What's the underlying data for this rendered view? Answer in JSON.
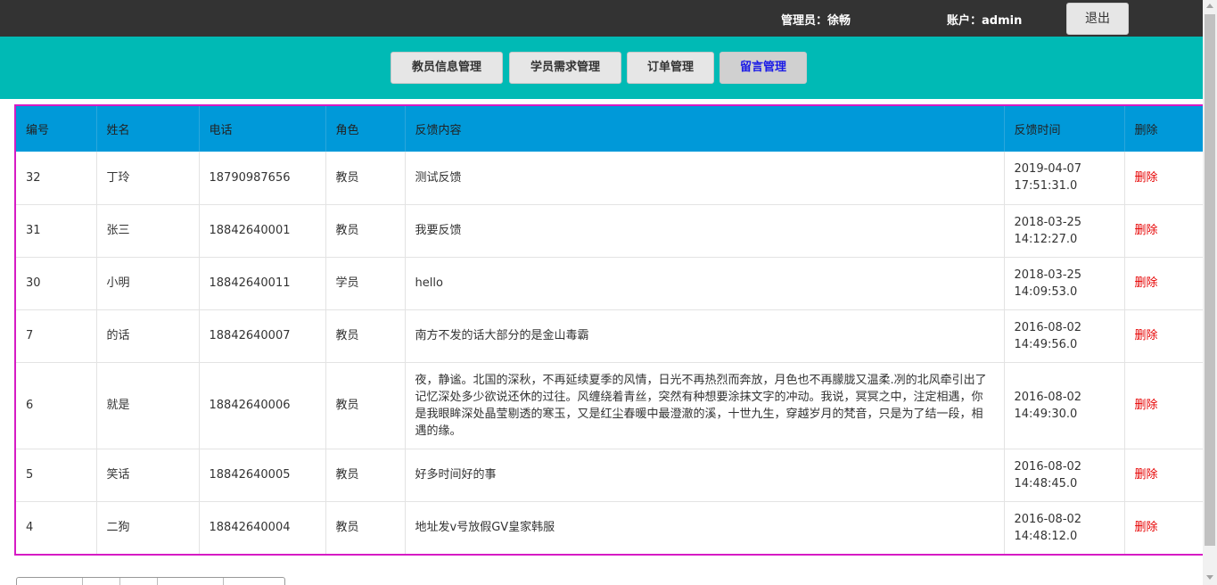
{
  "header": {
    "admin_label": "管理员：徐畅",
    "account_label": "账户：admin",
    "logout_label": "退出"
  },
  "nav": {
    "tabs": [
      {
        "label": "教员信息管理",
        "active": false
      },
      {
        "label": "学员需求管理",
        "active": false
      },
      {
        "label": "订单管理",
        "active": false
      },
      {
        "label": "留言管理",
        "active": true
      }
    ]
  },
  "table": {
    "columns": [
      "编号",
      "姓名",
      "电话",
      "角色",
      "反馈内容",
      "反馈时间",
      "删除"
    ],
    "rows": [
      {
        "id": "32",
        "name": "丁玲",
        "phone": "18790987656",
        "role": "教员",
        "content": "测试反馈",
        "time_date": "2019-04-07",
        "time_clock": "17:51:31.0",
        "action": "删除"
      },
      {
        "id": "31",
        "name": "张三",
        "phone": "18842640001",
        "role": "教员",
        "content": "我要反馈",
        "time_date": "2018-03-25",
        "time_clock": "14:12:27.0",
        "action": "删除"
      },
      {
        "id": "30",
        "name": "小明",
        "phone": "18842640011",
        "role": "学员",
        "content": "hello",
        "time_date": "2018-03-25",
        "time_clock": "14:09:53.0",
        "action": "删除"
      },
      {
        "id": "7",
        "name": "的话",
        "phone": "18842640007",
        "role": "教员",
        "content": "南方不发的话大部分的是金山毒霸",
        "time_date": "2016-08-02",
        "time_clock": "14:49:56.0",
        "action": "删除"
      },
      {
        "id": "6",
        "name": "就是",
        "phone": "18842640006",
        "role": "教员",
        "content": "夜，静谧。北国的深秋，不再延续夏季的风情，日光不再热烈而奔放，月色也不再朦胧又温柔.冽的北风牵引出了记忆深处多少欲说还休的过往。风缠绕着青丝，突然有种想要涂抹文字的冲动。我说，冥冥之中，注定相遇，你是我眼眸深处晶莹剔透的寒玉，又是红尘春暖中最澄澈的溪，十世九生，穿越岁月的梵音，只是为了结一段，相遇的缘。",
        "time_date": "2016-08-02",
        "time_clock": "14:49:30.0",
        "action": "删除"
      },
      {
        "id": "5",
        "name": "笑话",
        "phone": "18842640005",
        "role": "教员",
        "content": "好多时间好的事",
        "time_date": "2016-08-02",
        "time_clock": "14:48:45.0",
        "action": "删除"
      },
      {
        "id": "4",
        "name": "二狗",
        "phone": "18842640004",
        "role": "教员",
        "content": "地址发v号放假GV皇家韩服",
        "time_date": "2016-08-02",
        "time_clock": "14:48:12.0",
        "action": "删除"
      }
    ]
  },
  "colors": {
    "topbar": "#333333",
    "nav_band": "#00bab5",
    "table_header": "#0099d9",
    "table_border": "#d61bc4",
    "delete_link": "#e60000"
  }
}
